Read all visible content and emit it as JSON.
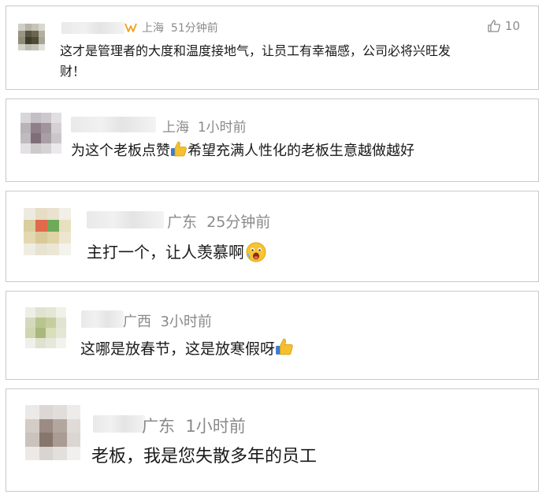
{
  "comments": [
    {
      "location": "上海",
      "time": "51分钟前",
      "text_line1": "这才是管理者的大度和温度接地气，让员工有幸福感，公司必将兴旺发",
      "text_line2": "财！",
      "likes": "10",
      "has_vip_badge": true,
      "like_icon": "thumbs-up-outline-icon"
    },
    {
      "location": "上海",
      "time": "1小时前",
      "text_before": "为这个老板点赞",
      "text_after": "希望充满人性化的老板生意越做越好",
      "emoji": "thumbs-up-emoji"
    },
    {
      "location": "广东",
      "time": "25分钟前",
      "text": "主打一个，让人羡慕啊",
      "emoji": "envious-face-emoji"
    },
    {
      "location": "广西",
      "time": "3小时前",
      "text": "这哪是放春节，这是放寒假呀",
      "emoji": "thumbs-up-emoji"
    },
    {
      "location": "广东",
      "time": "1小时前",
      "text": "老板，我是您失散多年的员工"
    }
  ]
}
